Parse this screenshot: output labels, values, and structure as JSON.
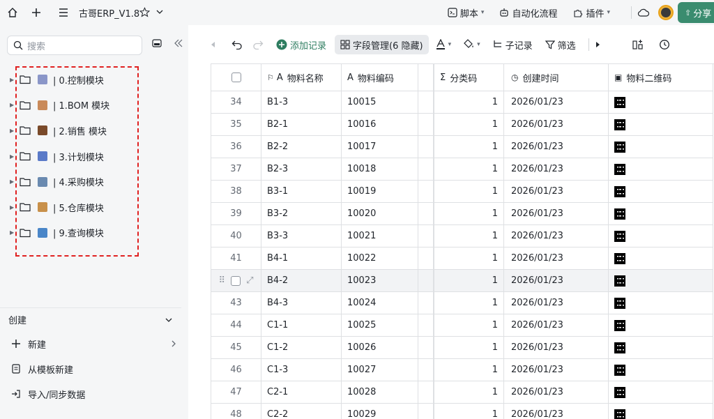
{
  "topbar": {
    "title": "古哥ERP_V1.8",
    "menus": [
      "脚本",
      "自动化流程",
      "插件"
    ],
    "share_label": "分享"
  },
  "sidebar": {
    "search_placeholder": "搜索",
    "tree": [
      {
        "label": "| 0.控制模块",
        "emoji_color": "#8a96c8"
      },
      {
        "label": "| 1.BOM 模块",
        "emoji_color": "#c98a5a"
      },
      {
        "label": "| 2.销售 模块",
        "emoji_color": "#7a4a2a"
      },
      {
        "label": "| 3.计划模块",
        "emoji_color": "#5a7ac8"
      },
      {
        "label": "| 4.采购模块",
        "emoji_color": "#6a8ab0"
      },
      {
        "label": "| 5.仓库模块",
        "emoji_color": "#c8904a"
      },
      {
        "label": "| 9.查询模块",
        "emoji_color": "#4a86c8"
      }
    ],
    "create_title": "创建",
    "create_items": [
      "新建",
      "从模板新建",
      "导入/同步数据"
    ]
  },
  "toolbar": {
    "add_record": "添加记录",
    "field_mgmt": "字段管理(6 隐藏)",
    "sub_record": "子记录",
    "filter": "筛选"
  },
  "table": {
    "headers": [
      "物料名称",
      "物料编码",
      "分类码",
      "创建时间",
      "物料二维码"
    ],
    "rows": [
      {
        "n": "34",
        "name": "B1-3",
        "code": "10015",
        "cat": "1",
        "date": "2026/01/23"
      },
      {
        "n": "35",
        "name": "B2-1",
        "code": "10016",
        "cat": "1",
        "date": "2026/01/23"
      },
      {
        "n": "36",
        "name": "B2-2",
        "code": "10017",
        "cat": "1",
        "date": "2026/01/23"
      },
      {
        "n": "37",
        "name": "B2-3",
        "code": "10018",
        "cat": "1",
        "date": "2026/01/23"
      },
      {
        "n": "38",
        "name": "B3-1",
        "code": "10019",
        "cat": "1",
        "date": "2026/01/23"
      },
      {
        "n": "39",
        "name": "B3-2",
        "code": "10020",
        "cat": "1",
        "date": "2026/01/23"
      },
      {
        "n": "40",
        "name": "B3-3",
        "code": "10021",
        "cat": "1",
        "date": "2026/01/23"
      },
      {
        "n": "41",
        "name": "B4-1",
        "code": "10022",
        "cat": "1",
        "date": "2026/01/23"
      },
      {
        "n": "",
        "name": "B4-2",
        "code": "10023",
        "cat": "1",
        "date": "2026/01/23",
        "hover": true
      },
      {
        "n": "43",
        "name": "B4-3",
        "code": "10024",
        "cat": "1",
        "date": "2026/01/23"
      },
      {
        "n": "44",
        "name": "C1-1",
        "code": "10025",
        "cat": "1",
        "date": "2026/01/23"
      },
      {
        "n": "45",
        "name": "C1-2",
        "code": "10026",
        "cat": "1",
        "date": "2026/01/23"
      },
      {
        "n": "46",
        "name": "C1-3",
        "code": "10027",
        "cat": "1",
        "date": "2026/01/23"
      },
      {
        "n": "47",
        "name": "C2-1",
        "code": "10028",
        "cat": "1",
        "date": "2026/01/23"
      },
      {
        "n": "48",
        "name": "C2-2",
        "code": "10029",
        "cat": "1",
        "date": "2026/01/23"
      }
    ]
  }
}
